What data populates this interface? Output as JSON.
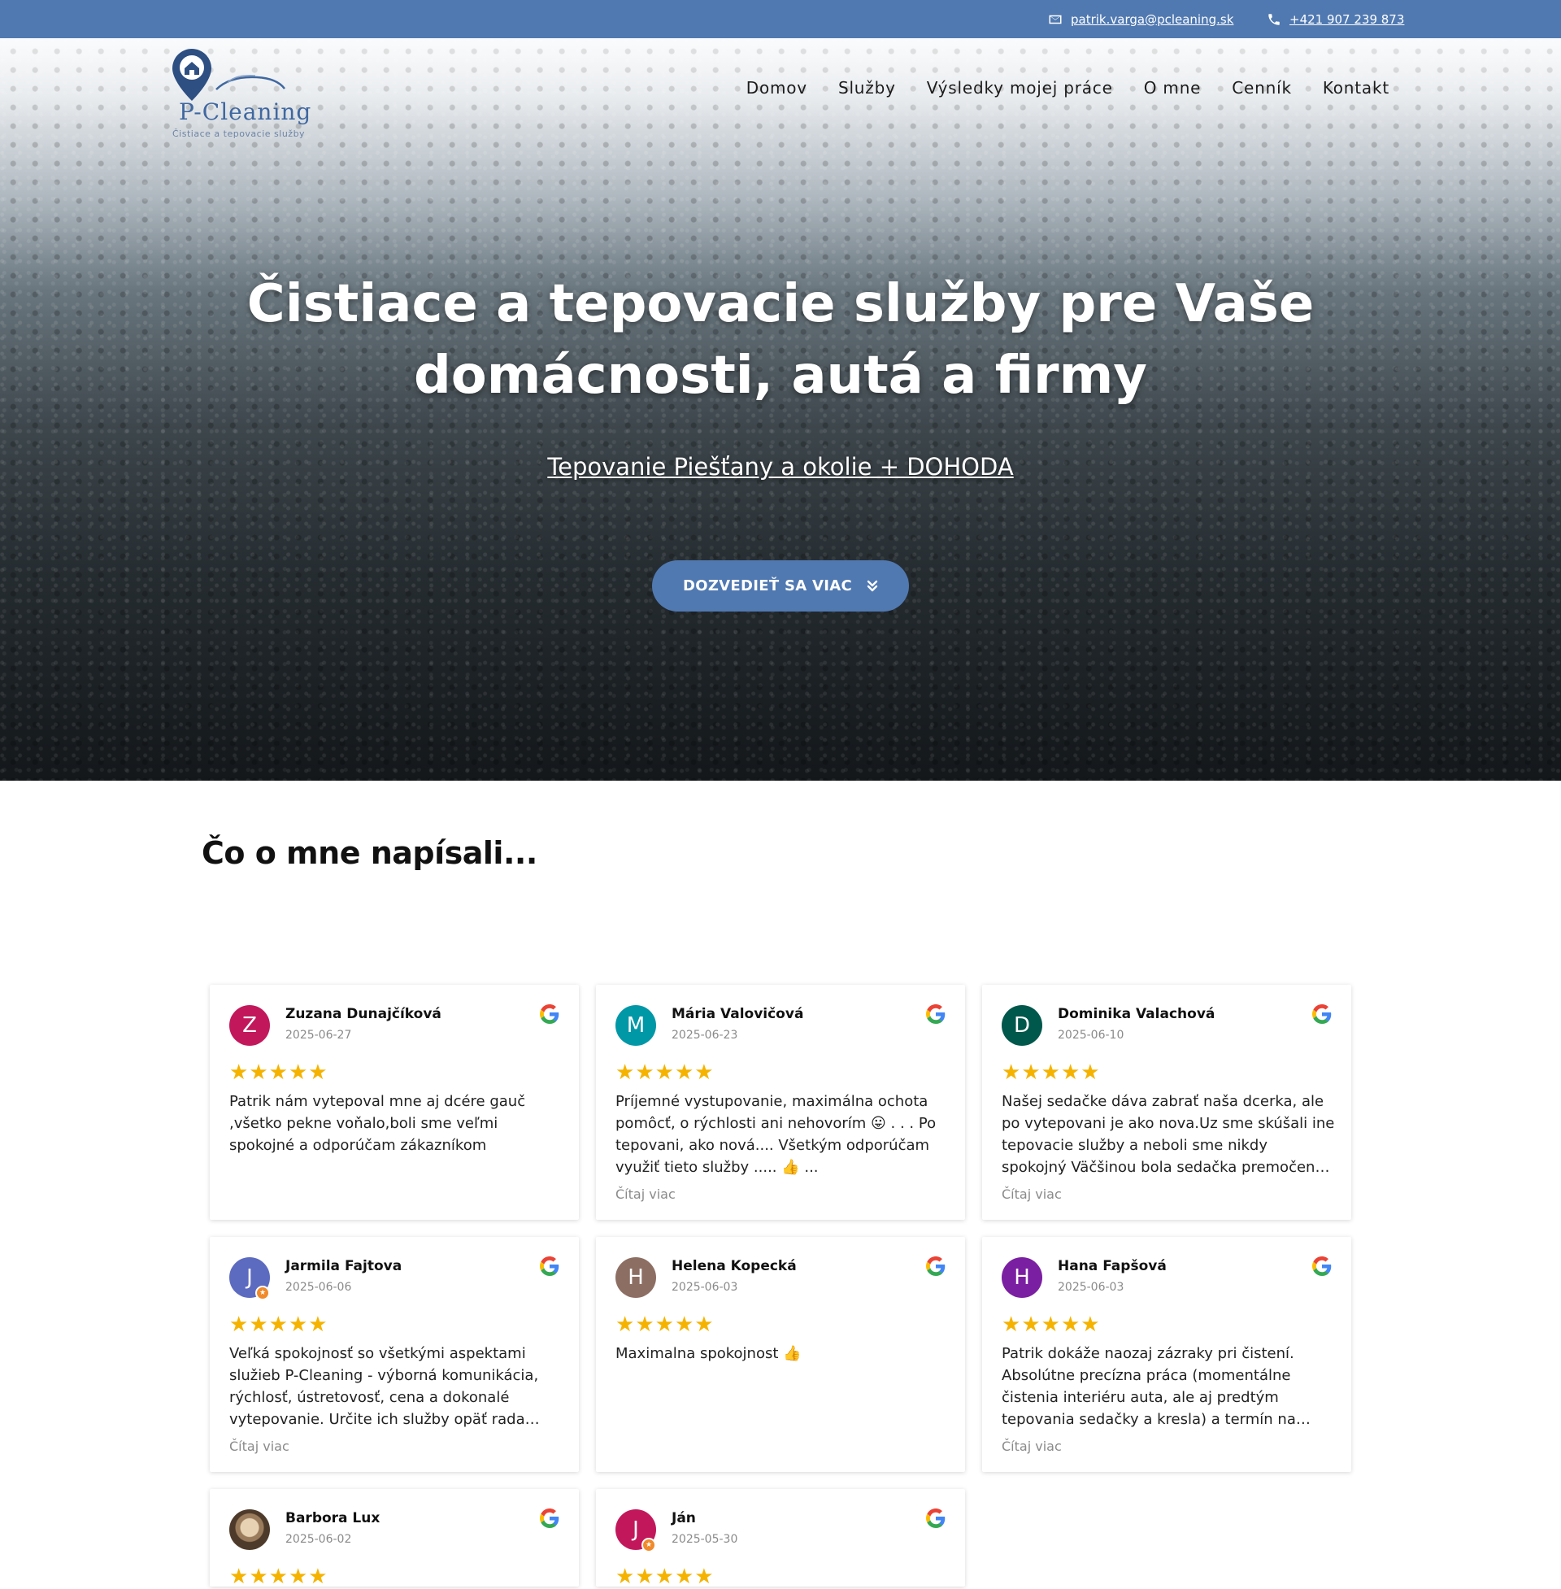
{
  "topbar": {
    "email": "patrik.varga@pcleaning.sk",
    "phone": "+421 907 239 873"
  },
  "logo": {
    "name": "P-Cleaning",
    "tagline": "Čistiace a tepovacie služby"
  },
  "nav": [
    "Domov",
    "Služby",
    "Výsledky mojej práce",
    "O mne",
    "Cenník",
    "Kontakt"
  ],
  "hero": {
    "title": "Čistiace a tepovacie služby pre Vaše domácnosti, autá a firmy",
    "subtitle": "Tepovanie Piešťany a okolie + DOHODA",
    "button": "DOZVEDIEŤ SA VIAC"
  },
  "reviews_title": "Čo o mne napísali...",
  "read_more": "Čítaj viac",
  "colors": {
    "accent": "#5079b1",
    "star": "#f5b300"
  },
  "reviews": [
    {
      "name": "Zuzana Dunajčíková",
      "date": "2025-06-27",
      "initial": "Z",
      "avatar_color": "#c2185b",
      "rating": 5,
      "text": "Patrik nám vytepoval mne aj dcére gauč ,všetko pekne voňalo,boli sme veľmi spokojné a odporúčam zákazníkom"
    },
    {
      "name": "Mária Valovičová",
      "date": "2025-06-23",
      "initial": "M",
      "avatar_color": "#0097a7",
      "rating": 5,
      "text": "Príjemné vystupovanie, maximálna ochota pomôcť, o rýchlosti ani nehovorím 😛 . . . Po tepovani, ako nová.... Všetkým odporúčam využiť tieto služby ..... 👍 ..."
    },
    {
      "name": "Dominika Valachová",
      "date": "2025-06-10",
      "initial": "D",
      "avatar_color": "#00574b",
      "rating": 5,
      "text": "Našej sedačke dáva zabrať naša dcerka, ale po vytepovani je ako nova.Uz sme skúšali ine tepovacie služby a neboli sme nikdy spokojný Väčšinou bola sedačka premočená a fľaky ost…"
    },
    {
      "name": "Jarmila Fajtova",
      "date": "2025-06-06",
      "initial": "J",
      "avatar_color": "#5c6bc0",
      "rating": 5,
      "text": "Veľká spokojnosť so všetkými aspektami služieb P-Cleaning - výborná komunikácia, rýchlosť, ústretovosť, cena a dokonalé vytepovanie. Určite ich služby opäť rada využijem a môžem…"
    },
    {
      "name": "Helena Kopecká",
      "date": "2025-06-03",
      "initial": "H",
      "avatar_color": "#8d6e63",
      "rating": 5,
      "text": "Maximalna spokojnost 👍"
    },
    {
      "name": "Hana Fapšová",
      "date": "2025-06-03",
      "initial": "H",
      "avatar_color": "#7b1fa2",
      "rating": 5,
      "text": "Patrik dokáže naozaj zázraky pri čistení. Absolútne precízna práca (momentálne čistenia interiéru auta, ale aj predtým tepovania sedačky a kresla) a termín na čistenie absolútne…"
    },
    {
      "name": "Barbora Lux",
      "date": "2025-06-02",
      "initial": "",
      "avatar_color": "#6d5a48",
      "rating": 5,
      "text": ""
    },
    {
      "name": "Ján",
      "date": "2025-05-30",
      "initial": "J",
      "avatar_color": "#c2185b",
      "rating": 5,
      "text": ""
    }
  ]
}
